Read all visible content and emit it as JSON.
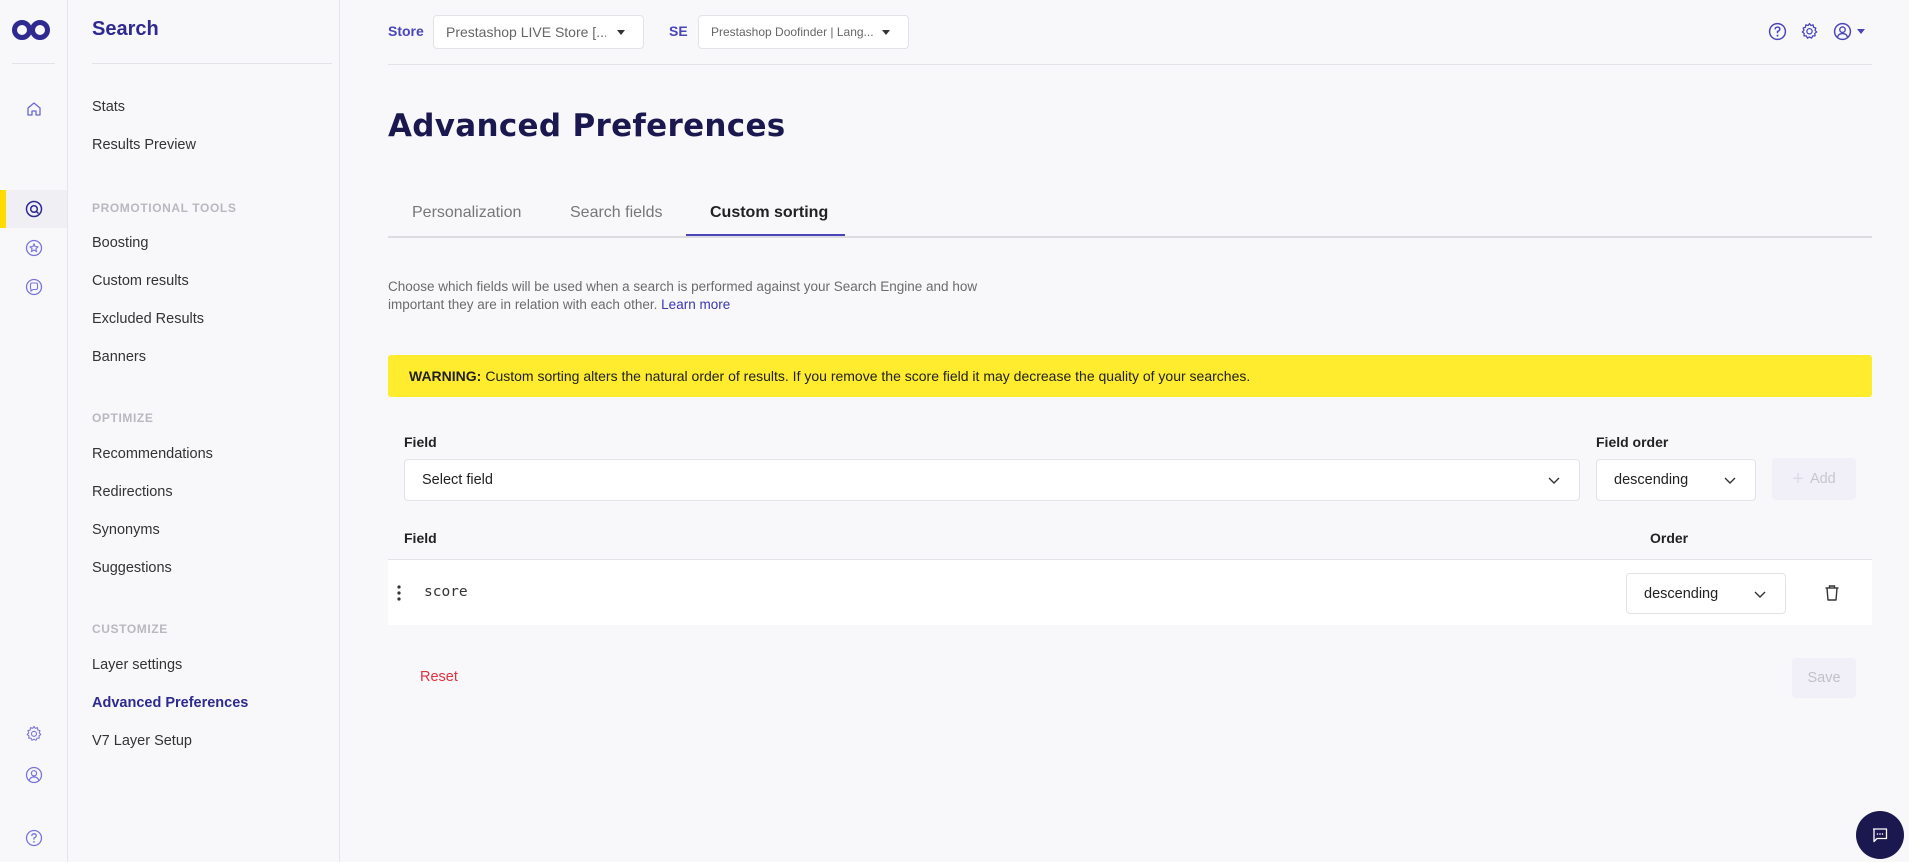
{
  "colors": {
    "brand": "#2e2a8f",
    "title": "#1b1850",
    "accent": "#4a45b8",
    "active_bar": "#ffdd00",
    "warning_bg": "#ffec2e",
    "danger": "#e0303d"
  },
  "rail": {
    "icons": [
      "logo-icon",
      "home-icon",
      "search-icon",
      "star-icon",
      "chat-bubble-icon",
      "gear-icon",
      "user-icon",
      "help-icon"
    ]
  },
  "sidenav": {
    "title": "Search",
    "items_top": [
      {
        "label": "Stats"
      },
      {
        "label": "Results Preview"
      }
    ],
    "sections": [
      {
        "title": "PROMOTIONAL TOOLS",
        "items": [
          {
            "label": "Boosting"
          },
          {
            "label": "Custom results"
          },
          {
            "label": "Excluded Results"
          },
          {
            "label": "Banners"
          }
        ]
      },
      {
        "title": "OPTIMIZE",
        "items": [
          {
            "label": "Recommendations"
          },
          {
            "label": "Redirections"
          },
          {
            "label": "Synonyms"
          },
          {
            "label": "Suggestions"
          }
        ]
      },
      {
        "title": "CUSTOMIZE",
        "items": [
          {
            "label": "Layer settings"
          },
          {
            "label": "Advanced Preferences",
            "active": true
          },
          {
            "label": "V7 Layer Setup"
          }
        ]
      }
    ]
  },
  "topbar": {
    "store_label": "Store",
    "store_value": "Prestashop LIVE Store [...",
    "se_label": "SE",
    "se_value": "Prestashop Doofinder | Lang..."
  },
  "main": {
    "title": "Advanced Preferences",
    "tabs": [
      {
        "label": "Personalization"
      },
      {
        "label": "Search fields"
      },
      {
        "label": "Custom sorting",
        "active": true
      }
    ],
    "description": "Choose which fields will be used when a search is performed against your Search Engine and how important they are in relation with each other.",
    "learn_more": "Learn more",
    "warning_strong": "WARNING:",
    "warning_text": "Custom sorting alters the natural order of results. If you remove the score field it may decrease the quality of your searches.",
    "form": {
      "field_label": "Field",
      "field_placeholder": "Select field",
      "order_label": "Field order",
      "order_value": "descending",
      "add_label": "Add"
    },
    "table": {
      "col_field": "Field",
      "col_order": "Order",
      "rows": [
        {
          "field": "score",
          "order": "descending"
        }
      ]
    },
    "reset_label": "Reset",
    "save_label": "Save"
  }
}
